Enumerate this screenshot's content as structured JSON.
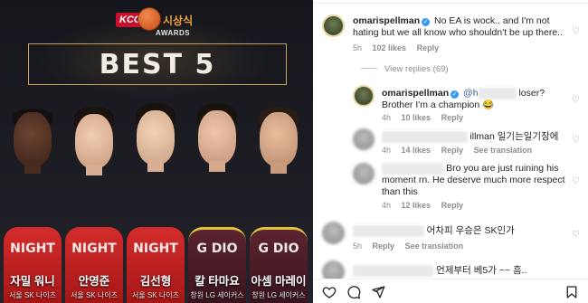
{
  "poster": {
    "logo_brand": "KCC",
    "logo_title": "시상식",
    "logo_sub": "AWARDS",
    "headline": "BEST 5",
    "players": [
      {
        "name": "자밀 워니",
        "team": "서울 SK 나이츠",
        "jersey_text": "NIGHT",
        "jersey": "red"
      },
      {
        "name": "안영준",
        "team": "서울 SK 나이츠",
        "jersey_text": "NIGHT",
        "jersey": "red"
      },
      {
        "name": "김선형",
        "team": "서울 SK 나이츠",
        "jersey_text": "NIGHT",
        "jersey": "red"
      },
      {
        "name": "칼 타마요",
        "team": "창원 LG 세이커스",
        "jersey_text": "G DIO",
        "jersey": "wine"
      },
      {
        "name": "아셈 마레이",
        "team": "창원 LG 세이커스",
        "jersey_text": "G DIO",
        "jersey": "wine"
      }
    ]
  },
  "comments": {
    "c1": {
      "user": "omarispellman",
      "text": "No EA is wock.. and I'm not hating but we all know who shouldn't be up there..",
      "time": "5h",
      "likes": "102 likes",
      "reply": "Reply"
    },
    "view_replies": "View replies (69)",
    "c2": {
      "user": "omarispellman",
      "mention": "@h",
      "mention_tail": "loser? Brother I'm a champion 😂",
      "time": "4h",
      "likes": "10 likes",
      "reply": "Reply"
    },
    "c3": {
      "text_tail": "illman 일기는일기장에",
      "time": "4h",
      "likes": "14 likes",
      "reply": "Reply",
      "translation": "See translation"
    },
    "c4": {
      "text": "Bro you are just ruining his moment rn. He deserve much more respect than this",
      "time": "4h",
      "likes": "12 likes",
      "reply": "Reply"
    },
    "c5": {
      "text_tail": "어차피 우승은 SK인가",
      "time": "5h",
      "reply": "Reply",
      "translation": "See translation"
    },
    "c6": {
      "text_tail": "언제부터 베5가 ~~ 흠.."
    }
  },
  "icons": [
    "heart-icon",
    "comment-icon",
    "share-icon",
    "bookmark-icon",
    "verified-icon"
  ],
  "colors": {
    "verified": "#3897f0",
    "muted": "#8e8e8e",
    "gold": "#c9a15a",
    "sk_red": "#c8102e"
  }
}
